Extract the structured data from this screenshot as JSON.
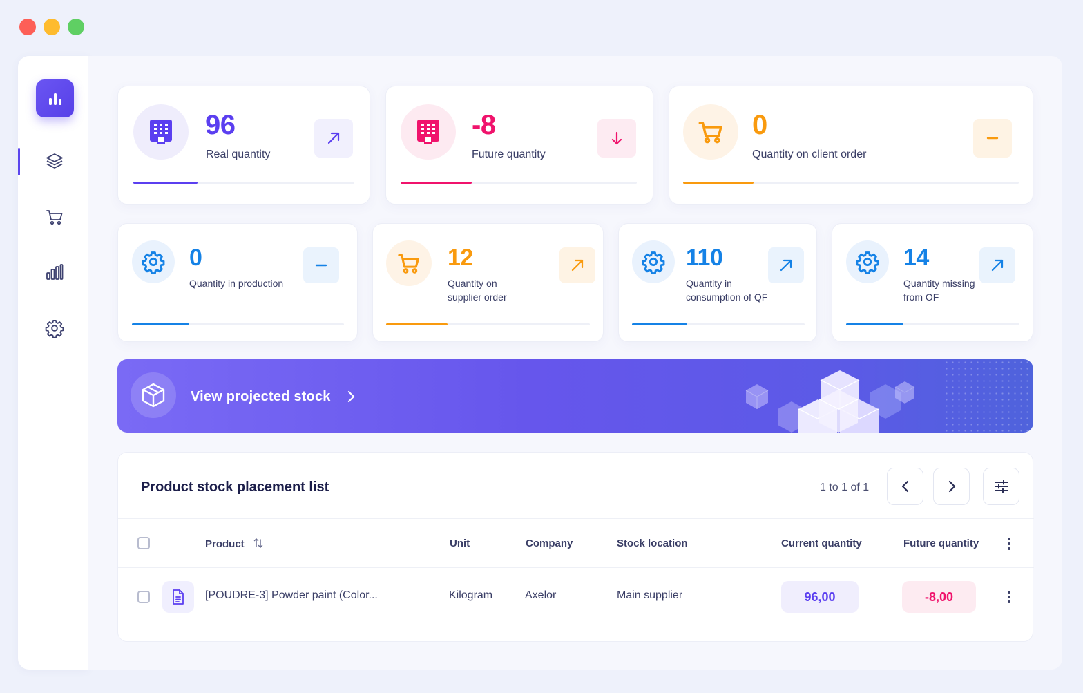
{
  "window": {
    "controls": [
      "close",
      "minimize",
      "maximize"
    ]
  },
  "sidebar": {
    "items": [
      {
        "name": "layers",
        "icon": "layers-icon"
      },
      {
        "name": "cart",
        "icon": "cart-icon"
      },
      {
        "name": "chart",
        "icon": "bar-chart-icon"
      },
      {
        "name": "settings",
        "icon": "gear-icon"
      }
    ],
    "active": "layers"
  },
  "stats_top": [
    {
      "value": "96",
      "label": "Real quantity",
      "color": "#5b3ff0",
      "trend": "up",
      "progress": 0.29
    },
    {
      "value": "-8",
      "label": "Future quantity",
      "color": "#f0136c",
      "trend": "down",
      "progress": 0.3
    },
    {
      "value": "0",
      "label": "Quantity on client order",
      "color": "#f99a0e",
      "trend": "flat",
      "progress": 0.21
    }
  ],
  "stats_bottom": [
    {
      "value": "0",
      "label_line1": "Quantity in production",
      "label_line2": "",
      "color": "#1582e6",
      "trend": "flat",
      "progress": 0.27
    },
    {
      "value": "12",
      "label_line1": "Quantity on",
      "label_line2": "supplier order",
      "color": "#f99a0e",
      "trend": "up",
      "progress": 0.3
    },
    {
      "value": "110",
      "label_line1": "Quantity in",
      "label_line2": "consumption of QF",
      "color": "#1582e6",
      "trend": "up",
      "progress": 0.32
    },
    {
      "value": "14",
      "label_line1": "Quantity missing",
      "label_line2": "from OF",
      "color": "#1582e6",
      "trend": "up",
      "progress": 0.33
    }
  ],
  "banner": {
    "label": "View projected stock"
  },
  "table": {
    "title": "Product stock placement list",
    "pager": "1 to 1 of 1",
    "columns": {
      "product": "Product",
      "unit": "Unit",
      "company": "Company",
      "location": "Stock location",
      "current": "Current quantity",
      "future": "Future quantity"
    },
    "rows": [
      {
        "product": "[POUDRE-3] Powder paint (Color...",
        "unit": "Kilogram",
        "company": "Axelor",
        "location": "Main supplier",
        "current": "96,00",
        "future": "-8,00"
      }
    ]
  }
}
